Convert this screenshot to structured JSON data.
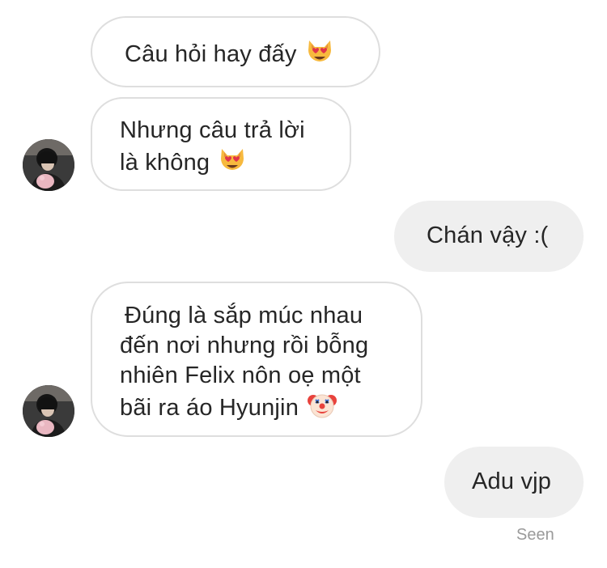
{
  "messages": [
    {
      "lines": [
        "Câu hỏi hay đấy"
      ],
      "emoji": "heart-eyes-cat-emoji",
      "direction": "incoming"
    },
    {
      "lines": [
        "Nhưng câu trả lời",
        "là không"
      ],
      "emoji": "heart-eyes-cat-emoji",
      "direction": "incoming"
    },
    {
      "lines": [
        "Chán vậy :("
      ],
      "direction": "outgoing"
    },
    {
      "lines": [
        "Đúng là sắp múc nhau",
        "đến nơi nhưng rồi bỗng",
        "nhiên Felix nôn oẹ một",
        "bãi ra áo Hyunjin"
      ],
      "emoji": "clown-face-emoji",
      "direction": "incoming"
    },
    {
      "lines": [
        "Adu vjp"
      ],
      "direction": "outgoing"
    }
  ],
  "status": {
    "seen": "Seen"
  },
  "colors": {
    "incoming_border": "#dedede",
    "outgoing_bg": "#efefef",
    "text": "#262626",
    "seen_text": "#9a9a9a"
  }
}
